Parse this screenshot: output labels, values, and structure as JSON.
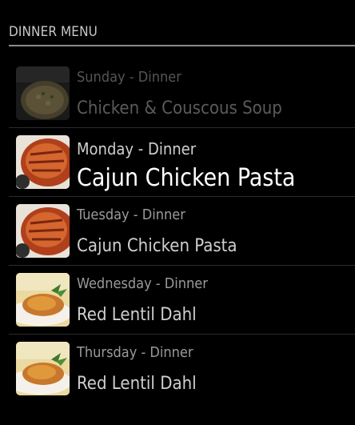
{
  "header": {
    "title": "DINNER MENU"
  },
  "meals": [
    {
      "day": "Sunday - Dinner",
      "dish": "Chicken & Couscous Soup",
      "image": "soup-icon",
      "state": "past"
    },
    {
      "day": "Monday - Dinner",
      "dish": "Cajun Chicken Pasta",
      "image": "cajun-chicken-icon",
      "state": "current"
    },
    {
      "day": "Tuesday - Dinner",
      "dish": "Cajun Chicken Pasta",
      "image": "cajun-chicken-icon",
      "state": "upcoming"
    },
    {
      "day": "Wednesday - Dinner",
      "dish": "Red Lentil Dahl",
      "image": "dahl-icon",
      "state": "upcoming"
    },
    {
      "day": "Thursday - Dinner",
      "dish": "Red Lentil Dahl",
      "image": "dahl-icon",
      "state": "upcoming"
    }
  ],
  "colors": {
    "background": "#000000",
    "divider": "#8a8a8a"
  }
}
